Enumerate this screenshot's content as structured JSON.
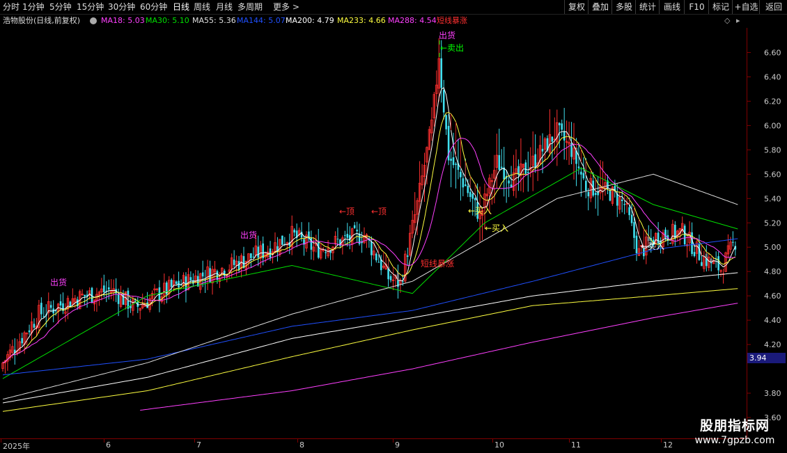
{
  "toolbar": {
    "periods": [
      "分时",
      "1分钟",
      "5分钟",
      "15分钟",
      "30分钟",
      "60分钟",
      "日线",
      "周线",
      "月线",
      "多周期",
      "更多 >"
    ],
    "active_period": "日线",
    "buttons": [
      "复权",
      "叠加",
      "多股",
      "统计",
      "画线",
      "F10",
      "标记",
      "+自选",
      "返回"
    ]
  },
  "info": {
    "title": "浩物股份(日线,前复权)",
    "ma": [
      {
        "label": "MA18: 5.03",
        "color": "#ff40ff"
      },
      {
        "label": "MA30: 5.10",
        "color": "#00e000"
      },
      {
        "label": "MA55: 5.36",
        "color": "#e0e0e0"
      },
      {
        "label": "MA144: 5.07",
        "color": "#2050ff"
      },
      {
        "label": "MA200: 4.79",
        "color": "#ffffff"
      },
      {
        "label": "MA233: 4.66",
        "color": "#ffff40"
      },
      {
        "label": "MA288: 4.54",
        "color": "#ff40ff"
      },
      {
        "label": "短线暴涨",
        "color": "#ff3030"
      }
    ]
  },
  "axis": {
    "ticks": [
      "6.60",
      "6.40",
      "6.20",
      "6.00",
      "5.80",
      "5.60",
      "5.40",
      "5.20",
      "5.00",
      "4.80",
      "4.60",
      "4.40",
      "4.20",
      "3.80",
      "3.60"
    ],
    "current_price": "3.94"
  },
  "time_axis": {
    "labels": [
      "2025年",
      "6",
      "7",
      "8",
      "9",
      "10",
      "11",
      "12"
    ]
  },
  "annotations": [
    {
      "text": "出货",
      "color": "#ff40ff"
    },
    {
      "text": "出货",
      "color": "#ff40ff"
    },
    {
      "text": "←顶",
      "color": "#ff3030"
    },
    {
      "text": "←顶",
      "color": "#ff3030"
    },
    {
      "text": "出货",
      "color": "#ff40ff"
    },
    {
      "text": "←卖出",
      "color": "#00ff00"
    },
    {
      "text": "短线暴涨",
      "color": "#ff3030"
    },
    {
      "text": "←买入",
      "color": "#ffff40"
    },
    {
      "text": "←买入",
      "color": "#ffff40"
    },
    {
      "text": "←买入",
      "color": "#ffffff"
    }
  ],
  "watermark": {
    "line1": "股朋指标网",
    "line2": "www.7gpzb.com"
  },
  "chart_data": {
    "type": "candlestick",
    "ylim": [
      3.6,
      6.7
    ],
    "colors": {
      "up": "#ff3030",
      "down": "#40e0f0",
      "ma18": "#ffffff",
      "ma30": "#ffff40",
      "ma55": "#ff40ff",
      "ma144": "#00e000",
      "ma200": "#e0e0e0",
      "ma233": "#2050ff",
      "ma288": "#ffffff"
    },
    "key_closes": [
      [
        0,
        4.05
      ],
      [
        15,
        4.45
      ],
      [
        30,
        4.58
      ],
      [
        45,
        4.65
      ],
      [
        55,
        4.5
      ],
      [
        65,
        4.62
      ],
      [
        80,
        4.75
      ],
      [
        95,
        4.85
      ],
      [
        110,
        4.98
      ],
      [
        120,
        5.1
      ],
      [
        130,
        4.98
      ],
      [
        140,
        5.05
      ],
      [
        150,
        5.1
      ],
      [
        160,
        4.75
      ],
      [
        165,
        4.7
      ],
      [
        172,
        5.35
      ],
      [
        178,
        6.0
      ],
      [
        181,
        6.55
      ],
      [
        185,
        5.75
      ],
      [
        192,
        5.5
      ],
      [
        198,
        5.25
      ],
      [
        205,
        5.7
      ],
      [
        212,
        5.55
      ],
      [
        220,
        5.7
      ],
      [
        230,
        5.95
      ],
      [
        236,
        5.8
      ],
      [
        242,
        5.5
      ],
      [
        252,
        5.45
      ],
      [
        258,
        5.35
      ],
      [
        264,
        4.95
      ],
      [
        272,
        5.1
      ],
      [
        282,
        5.12
      ],
      [
        290,
        4.92
      ],
      [
        298,
        4.82
      ],
      [
        304,
        5.05
      ]
    ],
    "overlays": {
      "ma144": [
        [
          0,
          3.92
        ],
        [
          60,
          4.6
        ],
        [
          120,
          4.85
        ],
        [
          170,
          4.62
        ],
        [
          200,
          5.2
        ],
        [
          240,
          5.65
        ],
        [
          270,
          5.35
        ],
        [
          305,
          5.15
        ]
      ],
      "ma233": [
        [
          0,
          3.95
        ],
        [
          60,
          4.08
        ],
        [
          120,
          4.35
        ],
        [
          170,
          4.48
        ],
        [
          220,
          4.72
        ],
        [
          270,
          4.98
        ],
        [
          305,
          5.07
        ]
      ],
      "ma200": [
        [
          0,
          3.75
        ],
        [
          60,
          4.05
        ],
        [
          120,
          4.45
        ],
        [
          170,
          4.72
        ],
        [
          230,
          5.4
        ],
        [
          270,
          5.6
        ],
        [
          305,
          5.35
        ]
      ],
      "ma288": [
        [
          0,
          3.72
        ],
        [
          60,
          3.93
        ],
        [
          120,
          4.25
        ],
        [
          170,
          4.42
        ],
        [
          220,
          4.6
        ],
        [
          270,
          4.72
        ],
        [
          305,
          4.79
        ]
      ],
      "ma30": [
        [
          0,
          3.65
        ],
        [
          60,
          3.82
        ],
        [
          120,
          4.1
        ],
        [
          170,
          4.32
        ],
        [
          220,
          4.52
        ],
        [
          270,
          4.6
        ],
        [
          305,
          4.66
        ]
      ],
      "magenta_long": [
        [
          57,
          3.66
        ],
        [
          120,
          3.82
        ],
        [
          170,
          4.0
        ],
        [
          220,
          4.22
        ],
        [
          270,
          4.42
        ],
        [
          305,
          4.54
        ]
      ]
    }
  }
}
